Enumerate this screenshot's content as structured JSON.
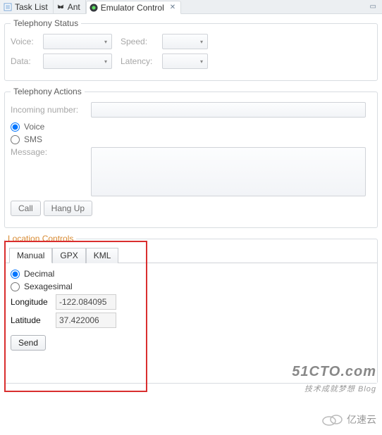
{
  "tabs": {
    "task_list": "Task List",
    "ant": "Ant",
    "emulator": "Emulator Control"
  },
  "telephony_status": {
    "legend": "Telephony Status",
    "voice_label": "Voice:",
    "speed_label": "Speed:",
    "data_label": "Data:",
    "latency_label": "Latency:"
  },
  "telephony_actions": {
    "legend": "Telephony Actions",
    "incoming_label": "Incoming number:",
    "voice_opt": "Voice",
    "sms_opt": "SMS",
    "message_label": "Message:",
    "call_btn": "Call",
    "hangup_btn": "Hang Up"
  },
  "location": {
    "legend": "Location Controls",
    "tab_manual": "Manual",
    "tab_gpx": "GPX",
    "tab_kml": "KML",
    "decimal_opt": "Decimal",
    "sexagesimal_opt": "Sexagesimal",
    "longitude_label": "Longitude",
    "latitude_label": "Latitude",
    "longitude_value": "-122.084095",
    "latitude_value": "37.422006",
    "send_btn": "Send"
  },
  "watermark": {
    "host": "51CTO.com",
    "sub": "技术成就梦想  Blog",
    "cloud": "亿速云"
  }
}
